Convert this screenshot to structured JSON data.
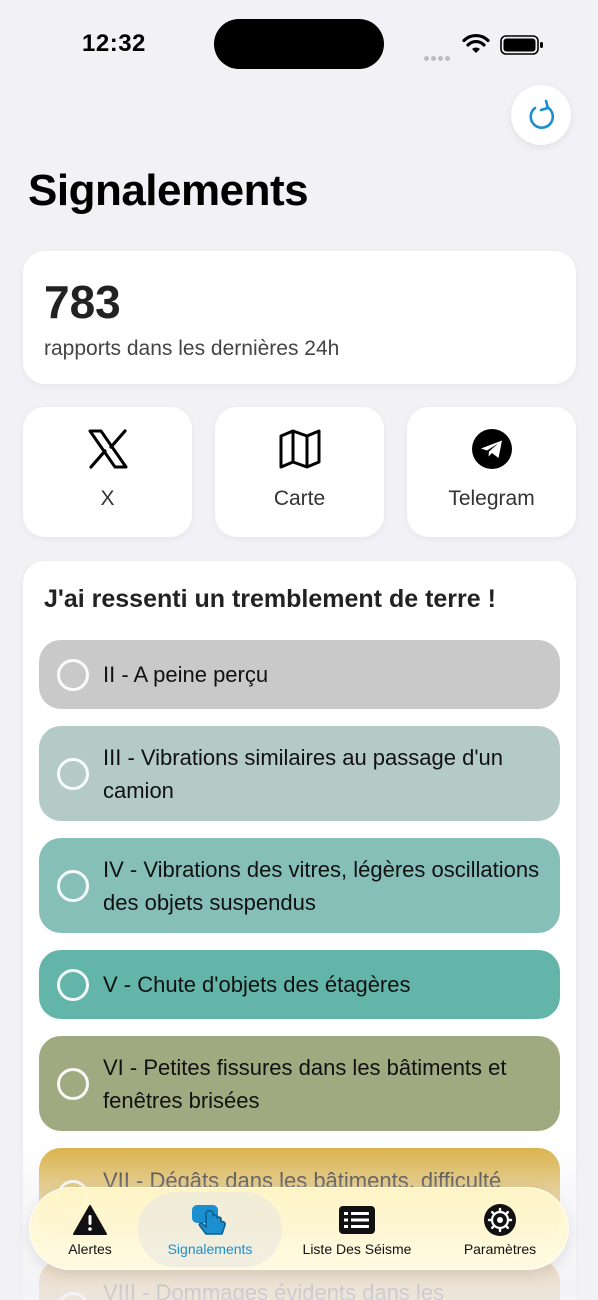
{
  "status_bar": {
    "time": "12:32"
  },
  "header": {
    "title": "Signalements"
  },
  "summary": {
    "count": "783",
    "label": "rapports dans les dernières 24h"
  },
  "shortcuts": [
    {
      "label": "X",
      "icon": "x-logo-icon"
    },
    {
      "label": "Carte",
      "icon": "map-icon"
    },
    {
      "label": "Telegram",
      "icon": "telegram-icon"
    }
  ],
  "felt": {
    "title": "J'ai ressenti un tremblement de terre !",
    "levels": [
      {
        "label": "II - A peine perçu",
        "color": "#C9C9C9"
      },
      {
        "label": "III - Vibrations similaires au passage d'un camion",
        "color": "#B4CAC6"
      },
      {
        "label": "IV - Vibrations des vitres, légères oscillations des objets suspendus",
        "color": "#86BEB8"
      },
      {
        "label": "V - Chute d'objets des étagères",
        "color": "#62B5A8"
      },
      {
        "label": "VI - Petites fissures dans les bâtiments et fenêtres brisées",
        "color": "#A0AA80"
      },
      {
        "label": "VII - Dégâts dans les bâtiments, difficulté",
        "color": "#D8AE3E"
      },
      {
        "label": "VIII - Dommages évidents dans les",
        "color": "#D49A44"
      }
    ]
  },
  "tabbar": {
    "items": [
      {
        "label": "Alertes"
      },
      {
        "label": "Signalements"
      },
      {
        "label": "Liste Des Séisme"
      },
      {
        "label": "Paramètres"
      }
    ],
    "active_color": "#1C8FD0"
  }
}
